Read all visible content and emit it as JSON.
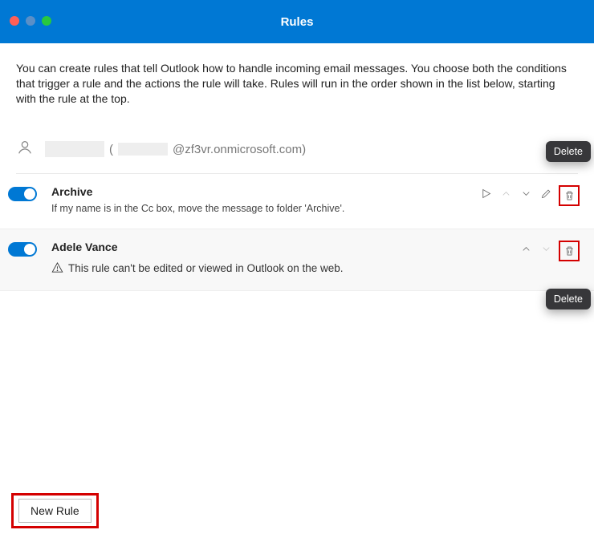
{
  "window": {
    "title": "Rules"
  },
  "intro": "You can create rules that tell Outlook how to handle incoming email messages. You choose both the conditions that trigger a rule and the actions the rule will take. Rules will run in the order shown in the list below, starting with the rule at the top.",
  "account": {
    "domain_fragment": "@zf3vr.onmicrosoft.com)",
    "open_paren": "("
  },
  "tooltips": {
    "delete": "Delete"
  },
  "rules": [
    {
      "enabled": true,
      "title": "Archive",
      "description": "If my name is in the Cc box, move the message to folder 'Archive'.",
      "editable": true
    },
    {
      "enabled": true,
      "title": "Adele Vance",
      "warning": "This rule can't be edited or viewed in Outlook on the web.",
      "editable": false
    }
  ],
  "footer": {
    "new_rule_label": "New Rule"
  }
}
